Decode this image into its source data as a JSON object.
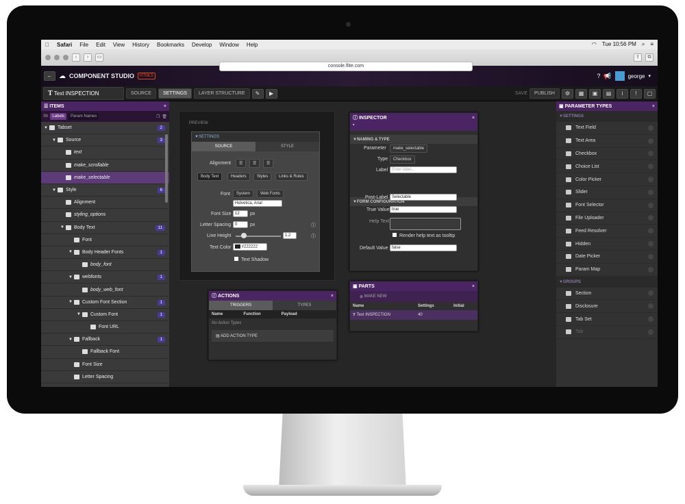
{
  "menubar": {
    "apple": "",
    "app": "Safari",
    "items": [
      "File",
      "Edit",
      "View",
      "History",
      "Bookmarks",
      "Develop",
      "Window",
      "Help"
    ],
    "clock": "Tue 10:56 PM"
  },
  "browser": {
    "url": "console.flite.com"
  },
  "app": {
    "title": "COMPONENT STUDIO",
    "badge": "HTML5",
    "user": "george"
  },
  "toolbar": {
    "component": "Text INSPECTION",
    "source": "SOURCE",
    "settings": "SETTINGS",
    "layer": "LAYER STRUCTURE",
    "save": "SAVE",
    "publish": "PUBLISH"
  },
  "items": {
    "title": "ITEMS",
    "tab_prefix": "Sh",
    "tab_labels": "Labels",
    "tab_params": "Param Names",
    "rows": [
      {
        "label": "Tabset",
        "badge": "2",
        "indent": 0,
        "italic": false
      },
      {
        "label": "Source",
        "badge": "3",
        "indent": 1,
        "italic": false
      },
      {
        "label": "text",
        "badge": "",
        "indent": 2,
        "italic": true
      },
      {
        "label": "make_scrollable",
        "badge": "",
        "indent": 2,
        "italic": true
      },
      {
        "label": "make_selectable",
        "badge": "",
        "indent": 2,
        "italic": true,
        "selected": true
      },
      {
        "label": "Style",
        "badge": "6",
        "indent": 1,
        "italic": false
      },
      {
        "label": "Alignment",
        "badge": "",
        "indent": 2,
        "italic": false
      },
      {
        "label": "styling_options",
        "badge": "",
        "indent": 2,
        "italic": true
      },
      {
        "label": "Body Text",
        "badge": "11",
        "indent": 2,
        "italic": false
      },
      {
        "label": "Font",
        "badge": "",
        "indent": 3,
        "italic": false
      },
      {
        "label": "Body Header Fonts",
        "badge": "1",
        "indent": 3,
        "italic": false
      },
      {
        "label": "body_font",
        "badge": "",
        "indent": 4,
        "italic": true
      },
      {
        "label": "webfonts",
        "badge": "1",
        "indent": 3,
        "italic": false
      },
      {
        "label": "body_web_font",
        "badge": "",
        "indent": 4,
        "italic": true
      },
      {
        "label": "Custom Font Section",
        "badge": "1",
        "indent": 3,
        "italic": false
      },
      {
        "label": "Custom Font",
        "badge": "1",
        "indent": 4,
        "italic": false
      },
      {
        "label": "Font URL",
        "badge": "",
        "indent": 5,
        "italic": false
      },
      {
        "label": "Fallback",
        "badge": "1",
        "indent": 3,
        "italic": false
      },
      {
        "label": "Fallback Font",
        "badge": "",
        "indent": 4,
        "italic": false
      },
      {
        "label": "Font Size",
        "badge": "",
        "indent": 3,
        "italic": false
      },
      {
        "label": "Letter Spacing",
        "badge": "",
        "indent": 3,
        "italic": false
      }
    ]
  },
  "preview": {
    "label": "PREVIEW",
    "settings": "SETTINGS",
    "tab_source": "SOURCE",
    "tab_style": "STYLE",
    "alignment": "Alignment",
    "sub_tabs": [
      "Body Text",
      "Headers",
      "Styles",
      "Links & Rules"
    ],
    "font": "Font",
    "font_system": "System",
    "font_web": "Web Fonts",
    "font_value": "Helvetica, Arial",
    "font_size": "Font Size",
    "font_size_value": "12",
    "px": "px",
    "letter_spacing": "Letter Spacing",
    "letter_spacing_value": "0",
    "line_height": "Line Height",
    "line_height_value": "1.2",
    "text_color": "Text Color",
    "text_color_value": "#222222",
    "text_shadow": "Text Shadow"
  },
  "inspector": {
    "title": "INSPECTOR",
    "naming": "NAMING & TYPE",
    "parameter": "Parameter",
    "parameter_value": "make_selectable",
    "type": "Type",
    "type_value": "Checkbox",
    "label": "Label",
    "label_placeholder": "Enter label...",
    "form": "FORM CONFIGURATION",
    "post_label": "Post-Label",
    "post_label_value": "Selectable",
    "true_value": "True Value",
    "true_value_value": "true",
    "help_text": "Help Text",
    "render_help": "Render help text as tooltip",
    "default_value": "Default Value",
    "default_value_value": "false"
  },
  "actions": {
    "title": "ACTIONS",
    "triggers": "TRIGGERS",
    "types": "TYPES",
    "col_name": "Name",
    "col_function": "Function",
    "col_payload": "Payload",
    "empty": "No Action Types",
    "add": "ADD ACTION TYPE"
  },
  "parts": {
    "title": "PARTS",
    "make_new": "MAKE NEW",
    "col_name": "Name",
    "col_settings": "Settings",
    "col_initial": "Initial",
    "row_name": "Text INSPECTION",
    "row_settings": "40"
  },
  "params": {
    "title": "PARAMETER TYPES",
    "settings": "SETTINGS",
    "groups": "GROUPS",
    "setting_items": [
      "Text Field",
      "Text Area",
      "Checkbox",
      "Choice List",
      "Color Picker",
      "Slider",
      "Font Selector",
      "File Uploader",
      "Feed Resolver",
      "Hidden",
      "Date Picker",
      "Param Map"
    ],
    "group_items": [
      "Section",
      "Disclosure",
      "Tab Set",
      "Tab"
    ]
  }
}
